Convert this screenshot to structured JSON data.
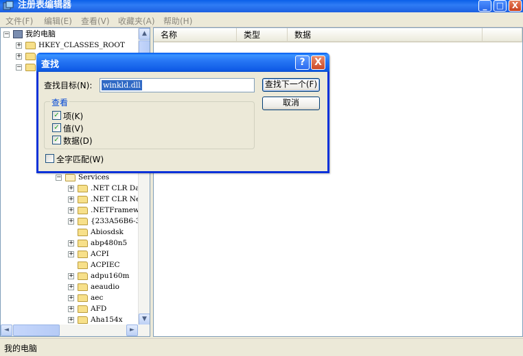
{
  "window": {
    "title": "注册表编辑器",
    "min_label": "_",
    "max_label": "□",
    "close_label": "X"
  },
  "menu": [
    {
      "label": "文件(F)"
    },
    {
      "label": "编辑(E)"
    },
    {
      "label": "查看(V)"
    },
    {
      "label": "收藏夹(A)"
    },
    {
      "label": "帮助(H)"
    }
  ],
  "tree": {
    "root": "我的电脑",
    "top_items": [
      {
        "label": "HKEY_CLASSES_ROOT",
        "expander": "+"
      }
    ],
    "services_label": "Services",
    "services_children": [
      {
        "label": ".NET CLR Da",
        "expander": "+"
      },
      {
        "label": ".NET CLR Ne",
        "expander": "+"
      },
      {
        "label": ".NETFramewo",
        "expander": "+"
      },
      {
        "label": "{233A56B6-3",
        "expander": "+"
      },
      {
        "label": "Abiosdsk",
        "expander": ""
      },
      {
        "label": "abp480n5",
        "expander": "+"
      },
      {
        "label": "ACPI",
        "expander": "+"
      },
      {
        "label": "ACPIEC",
        "expander": ""
      },
      {
        "label": "adpu160m",
        "expander": "+"
      },
      {
        "label": "aeaudio",
        "expander": "+"
      },
      {
        "label": "aec",
        "expander": "+"
      },
      {
        "label": "AFD",
        "expander": "+"
      },
      {
        "label": "Aha154x",
        "expander": "+"
      }
    ],
    "scroll_up": "▲",
    "scroll_down": "▼",
    "scroll_left": "◄",
    "scroll_right": "►"
  },
  "columns": [
    {
      "label": "名称"
    },
    {
      "label": "类型"
    },
    {
      "label": "数据"
    }
  ],
  "status": "我的电脑",
  "dialog": {
    "title": "查找",
    "help_label": "?",
    "close_label": "X",
    "find_label": "查找目标(N):",
    "find_value": "winkld.dll",
    "find_next": "查找下一个(F)",
    "cancel": "取消",
    "look_at_title": "查看",
    "options": [
      {
        "label": "项(K)",
        "checked": true
      },
      {
        "label": "值(V)",
        "checked": true
      },
      {
        "label": "数据(D)",
        "checked": true
      }
    ],
    "whole_match": {
      "label": "全字匹配(W)",
      "checked": false
    },
    "check_mark": "✓"
  }
}
